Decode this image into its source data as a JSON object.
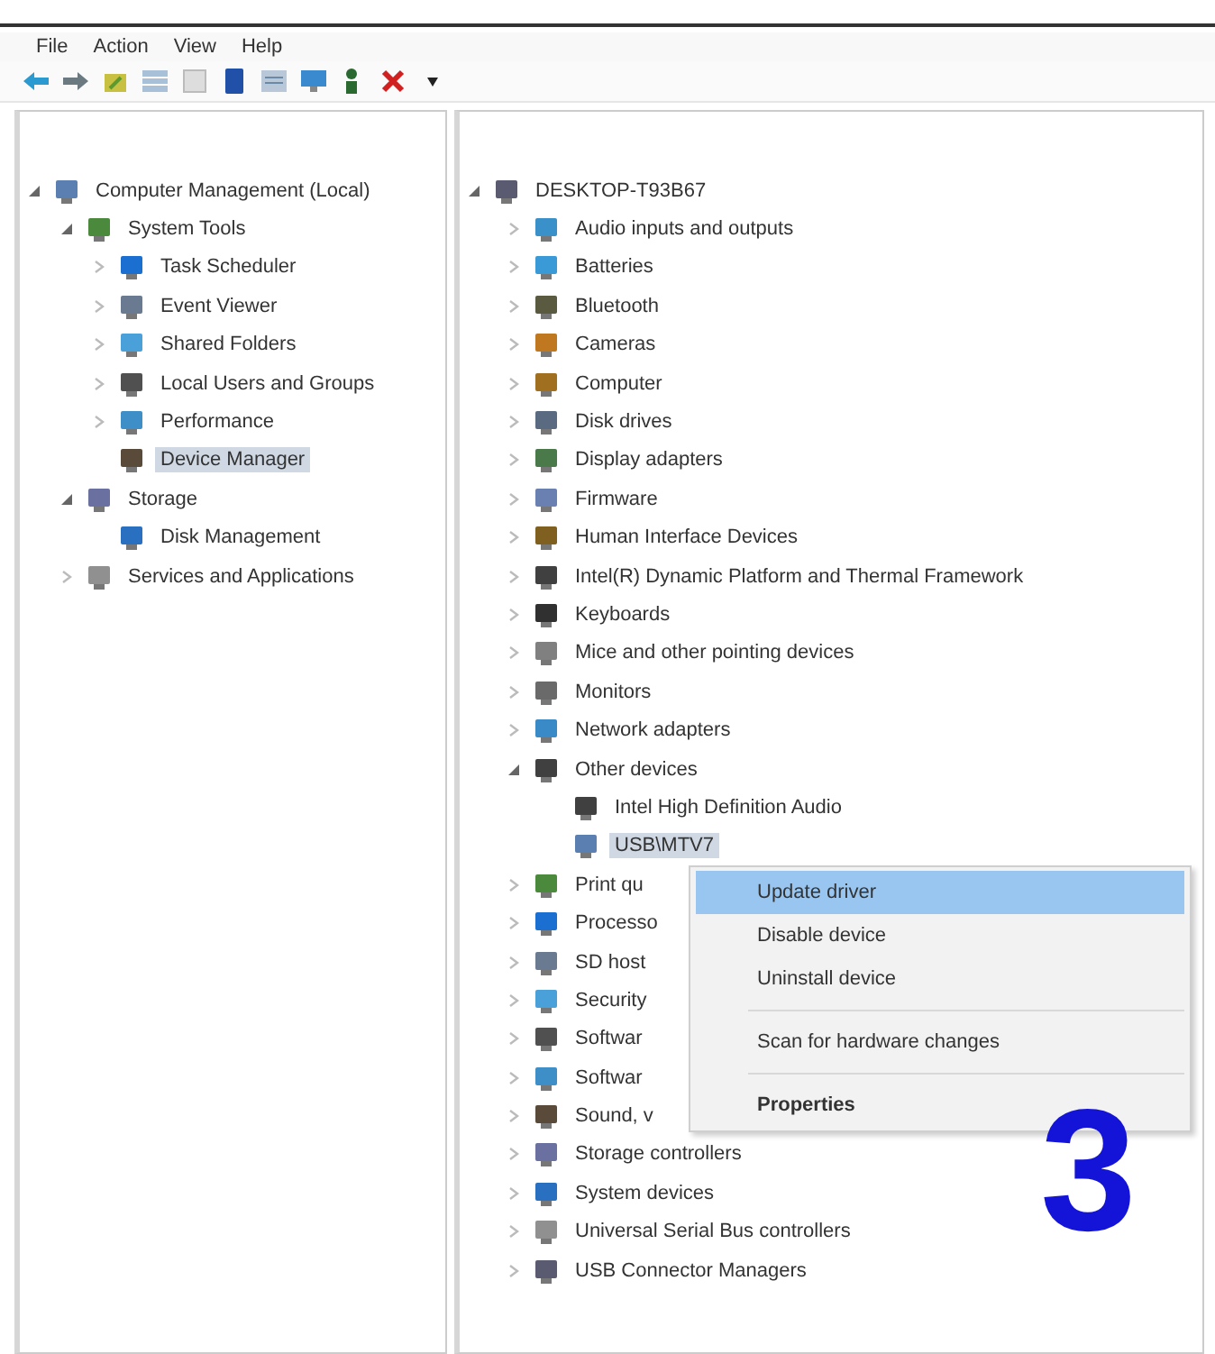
{
  "menu_bar": [
    "File",
    "Action",
    "View",
    "Help"
  ],
  "toolbar": [
    {
      "kind": "back"
    },
    {
      "kind": "forward"
    },
    {
      "kind": "folder"
    },
    {
      "kind": "grid"
    },
    {
      "kind": "blank"
    },
    {
      "kind": "book"
    },
    {
      "kind": "list"
    },
    {
      "kind": "monitor"
    },
    {
      "kind": "person"
    },
    {
      "kind": "delete"
    },
    {
      "kind": "down"
    }
  ],
  "navigation_tree": [
    {
      "label": "Computer Management (Local)",
      "selected": false,
      "expanded": true,
      "children": [
        {
          "label": "System Tools",
          "selected": false,
          "expanded": true,
          "children": [
            {
              "label": "Task Scheduler",
              "selected": false,
              "expanded": false
            },
            {
              "label": "Event Viewer",
              "selected": false,
              "expanded": false
            },
            {
              "label": "Shared Folders",
              "selected": false,
              "expanded": false
            },
            {
              "label": "Local Users and Groups",
              "selected": false,
              "expanded": false
            },
            {
              "label": "Performance",
              "selected": false,
              "expanded": false
            },
            {
              "label": "Device Manager",
              "selected": true
            }
          ]
        },
        {
          "label": "Storage",
          "selected": false,
          "expanded": true,
          "children": [
            {
              "label": "Disk Management",
              "selected": false
            }
          ]
        },
        {
          "label": "Services and Applications",
          "selected": false,
          "expanded": false
        }
      ]
    }
  ],
  "device_tree": [
    {
      "label": "DESKTOP-T93B67",
      "selected": false,
      "expanded": true,
      "children": [
        {
          "label": "Audio inputs and outputs",
          "selected": false,
          "expanded": false
        },
        {
          "label": "Batteries",
          "selected": false,
          "expanded": false
        },
        {
          "label": "Bluetooth",
          "selected": false,
          "expanded": false
        },
        {
          "label": "Cameras",
          "selected": false,
          "expanded": false
        },
        {
          "label": "Computer",
          "selected": false,
          "expanded": false
        },
        {
          "label": "Disk drives",
          "selected": false,
          "expanded": false
        },
        {
          "label": "Display adapters",
          "selected": false,
          "expanded": false
        },
        {
          "label": "Firmware",
          "selected": false,
          "expanded": false
        },
        {
          "label": "Human Interface Devices",
          "selected": false,
          "expanded": false
        },
        {
          "label": "Intel(R) Dynamic Platform and Thermal Framework",
          "selected": false,
          "expanded": false
        },
        {
          "label": "Keyboards",
          "selected": false,
          "expanded": false
        },
        {
          "label": "Mice and other pointing devices",
          "selected": false,
          "expanded": false
        },
        {
          "label": "Monitors",
          "selected": false,
          "expanded": false
        },
        {
          "label": "Network adapters",
          "selected": false,
          "expanded": false
        },
        {
          "label": "Other devices",
          "selected": false,
          "expanded": true,
          "children": [
            {
              "label": "Intel High Definition Audio",
              "selected": false
            },
            {
              "label": "USB\\MTV7",
              "selected": true
            }
          ]
        },
        {
          "label": "Print qu",
          "selected": false,
          "expanded": false
        },
        {
          "label": "Processo",
          "selected": false,
          "expanded": false
        },
        {
          "label": "SD host",
          "selected": false,
          "expanded": false
        },
        {
          "label": "Security",
          "selected": false,
          "expanded": false
        },
        {
          "label": "Softwar",
          "selected": false,
          "expanded": false
        },
        {
          "label": "Softwar",
          "selected": false,
          "expanded": false
        },
        {
          "label": "Sound, v",
          "selected": false,
          "expanded": false
        },
        {
          "label": "Storage controllers",
          "selected": false,
          "expanded": false
        },
        {
          "label": "System devices",
          "selected": false,
          "expanded": false
        },
        {
          "label": "Universal Serial Bus controllers",
          "selected": false,
          "expanded": false
        },
        {
          "label": "USB Connector Managers",
          "selected": false,
          "expanded": false
        }
      ]
    }
  ],
  "context_menu": [
    {
      "kind": "item",
      "label": "Update driver",
      "selected": true,
      "default": false
    },
    {
      "kind": "item",
      "label": "Disable device",
      "selected": false,
      "default": false
    },
    {
      "kind": "item",
      "label": "Uninstall device",
      "selected": false,
      "default": false
    },
    {
      "kind": "separator"
    },
    {
      "kind": "item",
      "label": "Scan for hardware changes",
      "selected": false,
      "default": false
    },
    {
      "kind": "separator"
    },
    {
      "kind": "item",
      "label": "Properties",
      "selected": false,
      "default": true
    }
  ],
  "annotation": {
    "text": "3"
  }
}
